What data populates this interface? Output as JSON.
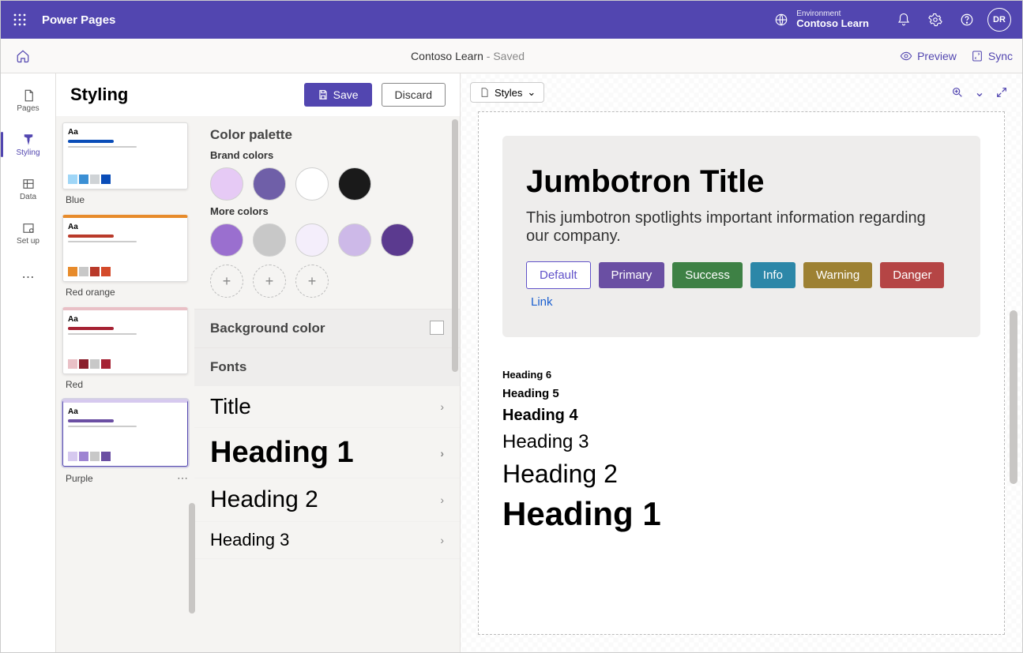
{
  "topbar": {
    "app_title": "Power Pages",
    "env_label": "Environment",
    "env_name": "Contoso Learn",
    "avatar_initials": "DR"
  },
  "cmdbar": {
    "doc_name": "Contoso Learn",
    "status": " - Saved",
    "preview": "Preview",
    "sync": "Sync"
  },
  "vnav": [
    {
      "id": "pages",
      "label": "Pages"
    },
    {
      "id": "styling",
      "label": "Styling"
    },
    {
      "id": "data",
      "label": "Data"
    },
    {
      "id": "setup",
      "label": "Set up"
    }
  ],
  "style": {
    "title": "Styling",
    "save": "Save",
    "discard": "Discard"
  },
  "themes": [
    {
      "name": "Blue",
      "accent": "#0a4db8",
      "swatches": [
        "#9fd6f7",
        "#3b8fd4",
        "#cfd3d6",
        "#0a4db8"
      ]
    },
    {
      "name": "Red orange",
      "accent": "#e17a1d",
      "swatches": [
        "#e78b2b",
        "#c8c8c8",
        "#b93a2a",
        "#d44a2a"
      ]
    },
    {
      "name": "Red",
      "accent": "#a52233",
      "swatches": [
        "#e9c0c6",
        "#8b1f2c",
        "#c8c8c8",
        "#a52233"
      ]
    },
    {
      "name": "Purple",
      "accent": "#8a6fc7",
      "swatches": [
        "#d6c9ef",
        "#9e84d2",
        "#c8c8c8",
        "#6b4fa3"
      ],
      "selected": true,
      "showMore": true
    }
  ],
  "palette": {
    "title": "Color palette",
    "brand_label": "Brand colors",
    "brand_colors": [
      "#e6caf5",
      "#6f5fa8",
      "#ffffff",
      "#1a1a1a"
    ],
    "more_label": "More colors",
    "more_colors": [
      "#9a6fcf",
      "#c8c8c8",
      "#f4eefb",
      "#cdb9e8",
      "#5b3a8f"
    ]
  },
  "bg": {
    "title": "Background color"
  },
  "fonts": {
    "title": "Fonts",
    "rows": [
      "Title",
      "Heading 1",
      "Heading 2",
      "Heading 3"
    ]
  },
  "canvas": {
    "styles_chip": "Styles",
    "jumbo_title": "Jumbotron Title",
    "jumbo_text": "This jumbotron spotlights important information regarding our company.",
    "buttons": {
      "default": "Default",
      "primary": "Primary",
      "success": "Success",
      "info": "Info",
      "warning": "Warning",
      "danger": "Danger",
      "link": "Link"
    },
    "headings": {
      "h6": "Heading 6",
      "h5": "Heading 5",
      "h4": "Heading 4",
      "h3": "Heading 3",
      "h2": "Heading 2",
      "h1": "Heading 1"
    }
  }
}
